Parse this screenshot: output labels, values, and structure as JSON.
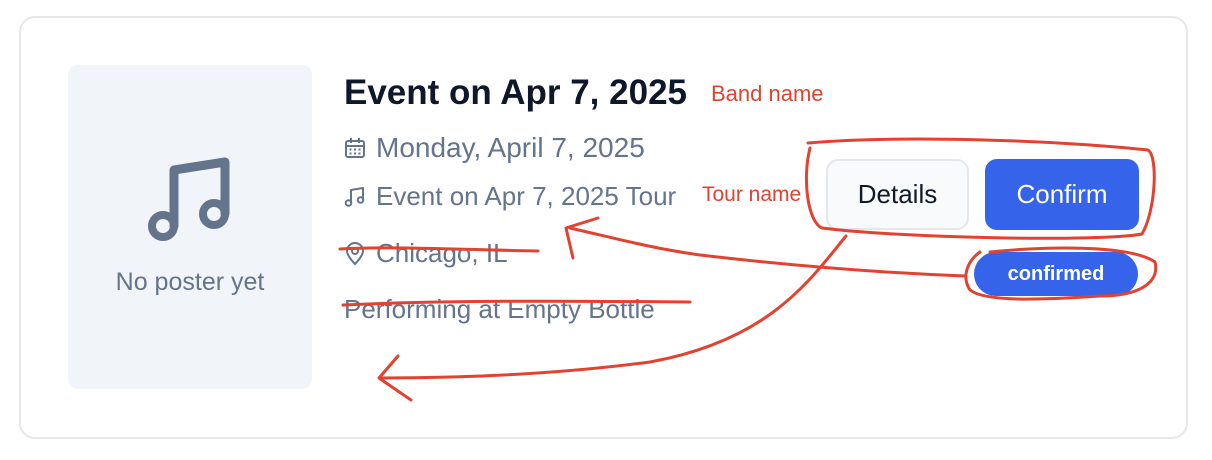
{
  "poster": {
    "placeholder_text": "No poster yet",
    "icon": "music-note-icon"
  },
  "event": {
    "title": "Event on Apr 7, 2025",
    "date": "Monday, April 7, 2025",
    "tour": "Event on Apr 7, 2025 Tour",
    "location": "Chicago, IL",
    "performing": "Performing at Empty Bottle"
  },
  "actions": {
    "details_label": "Details",
    "confirm_label": "Confirm"
  },
  "status": {
    "badge": "confirmed"
  },
  "annotations": {
    "band_name": "Band name",
    "tour_name": "Tour name"
  },
  "colors": {
    "primary": "#3563e9",
    "annotation": "#e2422f",
    "muted_text": "#64748b",
    "poster_bg": "#f1f4f8"
  }
}
